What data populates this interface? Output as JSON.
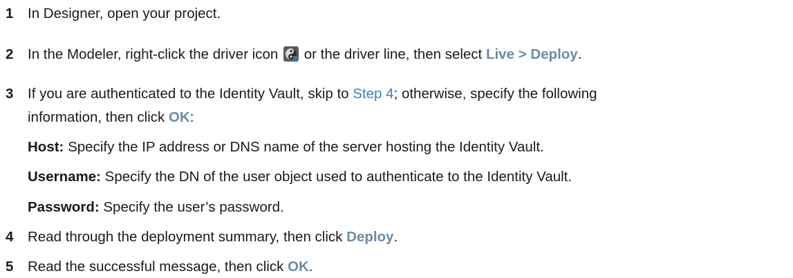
{
  "steps": [
    {
      "number": "1",
      "text": "In Designer, open your project."
    },
    {
      "number": "2",
      "text_a": "In the Modeler, right-click the driver icon",
      "icon": "driver-icon",
      "text_b": "or the driver line, then select",
      "ui": "Live > Deploy",
      "text_c": "."
    },
    {
      "number": "3",
      "text_a": "If you are authenticated to the Identity Vault, skip to",
      "link": "Step 4",
      "text_b": "; otherwise, specify the following",
      "line2_a": "information, then click",
      "ui": "OK",
      "line2_b": ":",
      "fields": [
        {
          "term": "Host:",
          "desc": "Specify the IP address or DNS name of the server hosting the Identity Vault."
        },
        {
          "term": "Username:",
          "desc": "Specify the DN of the user object used to authenticate to the Identity Vault."
        },
        {
          "term": "Password:",
          "desc": "Specify the user’s password."
        }
      ]
    },
    {
      "number": "4",
      "text_a": "Read through the deployment summary, then click",
      "ui": "Deploy",
      "text_b": "."
    },
    {
      "number": "5",
      "text_a": "Read the successful message, then click",
      "ui": "OK",
      "text_b": "."
    }
  ],
  "colors": {
    "ui_text": "#6e8aa6",
    "link": "#3f7fc0"
  }
}
